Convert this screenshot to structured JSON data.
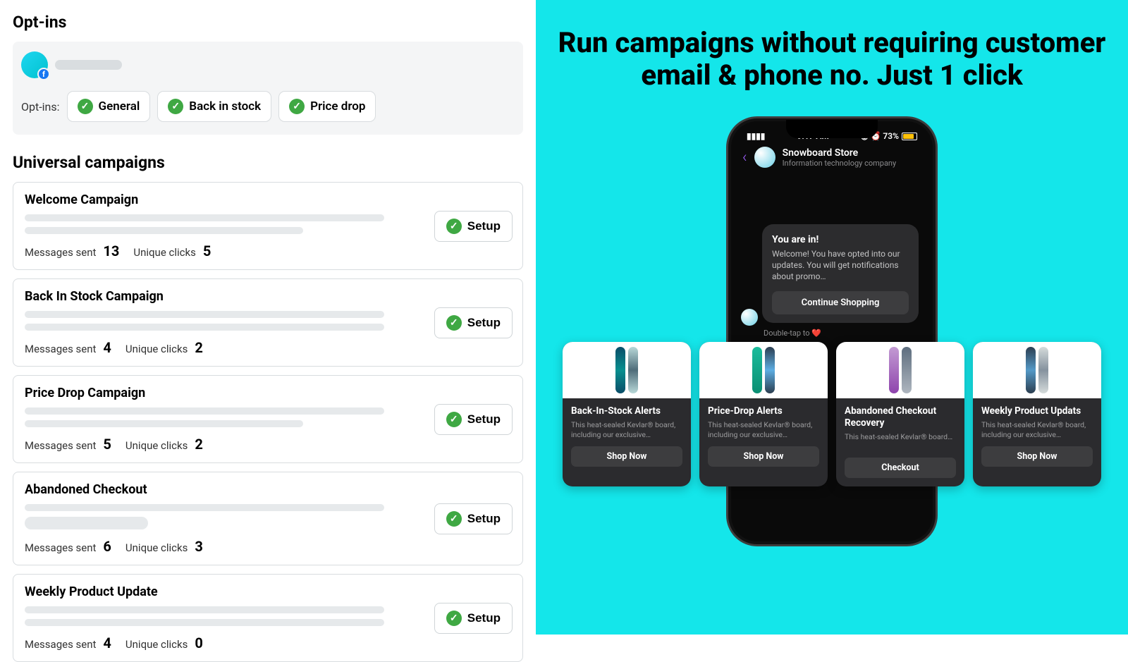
{
  "left": {
    "optins_heading": "Opt-ins",
    "optins_label": "Opt-ins:",
    "chips": [
      "General",
      "Back in stock",
      "Price drop"
    ],
    "universal_heading": "Universal campaigns",
    "setup_label": "Setup",
    "msgs_label": "Messages sent",
    "clicks_label": "Unique clicks",
    "campaigns": [
      {
        "title": "Welcome Campaign",
        "msgs": "13",
        "clicks": "5",
        "skel2": "w2"
      },
      {
        "title": "Back In Stock Campaign",
        "msgs": "4",
        "clicks": "2",
        "skel2": "w3"
      },
      {
        "title": "Price Drop Campaign",
        "msgs": "5",
        "clicks": "2",
        "skel2": "w2"
      },
      {
        "title": "Abandoned Checkout",
        "msgs": "6",
        "clicks": "3",
        "skel2": "w4"
      },
      {
        "title": "Weekly Product Update",
        "msgs": "4",
        "clicks": "0",
        "skel2": "w3"
      }
    ]
  },
  "right": {
    "headline": "Run campaigns without requiring customer email & phone no. Just 1 click",
    "phone": {
      "time": "9:17 AM",
      "battery": "73%",
      "store_name": "Snowboard Store",
      "store_sub": "Information technology company",
      "msg_title": "You are in!",
      "msg_body": "Welcome! You have opted into our updates. You will get notifications about promo…",
      "msg_btn": "Continue Shopping",
      "double_tap": "Double-tap to "
    },
    "cards": [
      {
        "title": "Back-In-Stock Alerts",
        "desc": "This heat-sealed Kevlar® board, including our exclusive…",
        "btn": "Shop Now",
        "boards": [
          "b1a",
          "b1b"
        ]
      },
      {
        "title": "Price-Drop Alerts",
        "desc": "This heat-sealed Kevlar® board, including our exclusive…",
        "btn": "Shop Now",
        "boards": [
          "b2a",
          "b2b"
        ]
      },
      {
        "title": "Abandoned Checkout Recovery",
        "desc": "This heat-sealed Kevlar® board…",
        "btn": "Checkout",
        "boards": [
          "b3a",
          "b3b"
        ],
        "tall": true
      },
      {
        "title": "Weekly Product Updats",
        "desc": "This heat-sealed Kevlar® board, including our exclusive…",
        "btn": "Shop Now",
        "boards": [
          "b4a",
          "b4b"
        ]
      }
    ]
  }
}
